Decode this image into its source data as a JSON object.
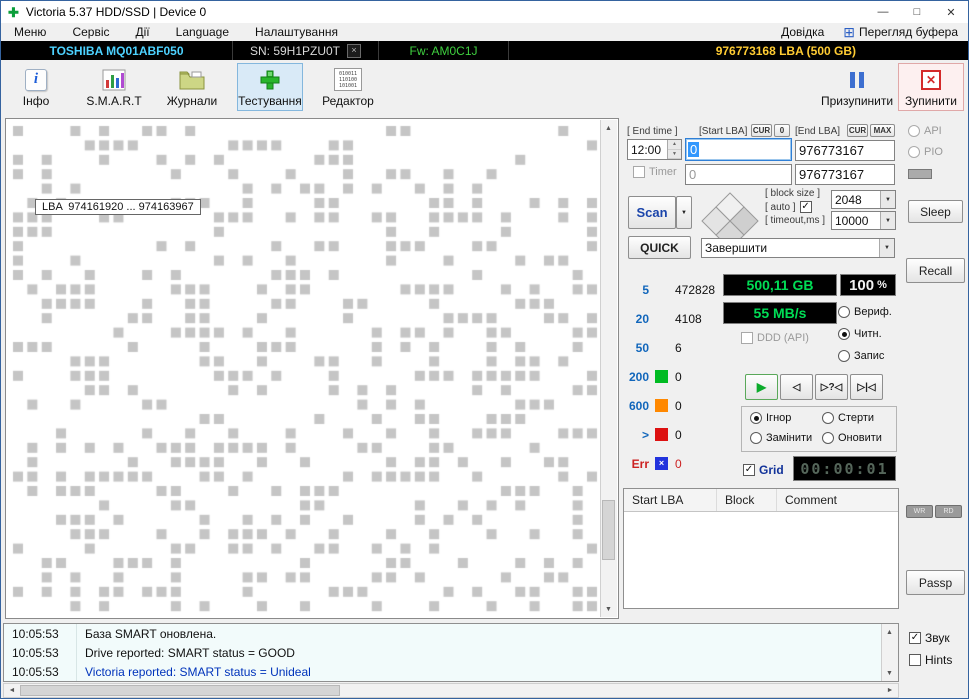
{
  "colors": {
    "model_text": "#4dd2ff",
    "firmware_text": "#3fcf3f",
    "capacity_text": "#ffcc33",
    "display_green": "#00dd55",
    "log_highlight": "#0033bb",
    "stat_label_blue": "#1166bb",
    "err_red": "#cc2222",
    "selected_tool_bg": "#d9eaf7"
  },
  "glyphs": {
    "app": "✚",
    "minimize": "—",
    "maximize": "□",
    "close": "✕",
    "buffer_grid": "⊞",
    "info_i": "i",
    "stop_x": "✕",
    "serial_close": "×",
    "up": "▲",
    "down": "▼",
    "left": "◄",
    "right": "►",
    "dropdown": "▼",
    "check": "✓"
  },
  "window": {
    "title": "Victoria 5.37 HDD/SSD | Device 0"
  },
  "menu": {
    "items": [
      "Меню",
      "Сервіс",
      "Дії",
      "Language",
      "Налаштування"
    ],
    "help": "Довідка",
    "buffer_view": "Перегляд буфера"
  },
  "device": {
    "model": "TOSHIBA MQ01ABF050",
    "serial": "SN: 59H1PZU0T",
    "firmware": "Fw: AM0C1J",
    "capacity": "976773168 LBA (500 GB)"
  },
  "toolbar": {
    "info": "Інфо",
    "smart": "S.M.A.R.T",
    "journals": "Журнали",
    "testing": "Тестування",
    "editor": "Редактор",
    "editor_icon_lines": [
      "010011",
      "110100",
      "101001"
    ],
    "pause": "Призупинити",
    "stop": "Зупинити"
  },
  "scan": {
    "tooltip": "LBA  974161920 ... 974163967"
  },
  "controls": {
    "end_time_label": "[ End time ]",
    "end_time_value": "12:00",
    "start_lba_label": "[Start LBA]",
    "end_lba_label": "[End LBA]",
    "cur_label": "CUR",
    "zero_label": "0",
    "max_label": "MAX",
    "start_lba_value": "0",
    "end_lba_value": "976773167",
    "timer_label": "Timer",
    "timer_value": "0",
    "end_lba_value_2": "976773167",
    "scan_button": "Scan",
    "quick_button": "QUICK",
    "finish_select": "Завершити",
    "block_size_label": "[ block size ]",
    "auto_label": "[ auto ]",
    "block_size_value": "2048",
    "timeout_label": "[ timeout,ms ]",
    "timeout_value": "10000"
  },
  "stats": {
    "rows": [
      {
        "label": "5",
        "square": "#f0f0f0",
        "glyph": "",
        "value": "472828"
      },
      {
        "label": "20",
        "square": "#f0f0f0",
        "glyph": "",
        "value": "4108"
      },
      {
        "label": "50",
        "square": "#f0f0f0",
        "glyph": "",
        "value": "6"
      },
      {
        "label": "200",
        "square": "#00bb22",
        "glyph": "",
        "value": "0"
      },
      {
        "label": "600",
        "square": "#ff8800",
        "glyph": "",
        "value": "0"
      },
      {
        "label": ">",
        "square": "#dd1111",
        "glyph": "",
        "value": "0"
      },
      {
        "label": "Err",
        "square": "#2233dd",
        "glyph": "×",
        "value": "0"
      }
    ]
  },
  "displays": {
    "capacity": "500,11 GB",
    "percent_value": "100",
    "percent_unit": "%",
    "speed": "55 MB/s",
    "ddd_label": "DDD (API)",
    "grid_label": "Grid",
    "elapsed": "00:00:01"
  },
  "mode_radios": {
    "verify": "Вериф.",
    "read": "Читн.",
    "write": "Запис"
  },
  "media": {
    "play": "▶",
    "prev": "◁",
    "seek": "▷?◁",
    "jump": "▷|◁"
  },
  "action_radios": {
    "ignore": "Ігнор",
    "erase": "Стерти",
    "remap": "Замінити",
    "restore": "Оновити"
  },
  "table": {
    "headers": [
      "Start LBA",
      "Block",
      "Comment"
    ]
  },
  "side": {
    "api": "API",
    "pio": "PIO",
    "sleep": "Sleep",
    "recall": "Recall",
    "wr": "WR",
    "rd": "RD",
    "passp": "Passp"
  },
  "log": {
    "entries": [
      {
        "time": "10:05:53",
        "message": "База SMART оновлена."
      },
      {
        "time": "10:05:53",
        "message": "Drive reported: SMART status = GOOD"
      },
      {
        "time": "10:05:53",
        "message": "Victoria reported: SMART status = Unideal"
      }
    ]
  },
  "footer": {
    "sound": "Звук",
    "hints": "Hints"
  }
}
